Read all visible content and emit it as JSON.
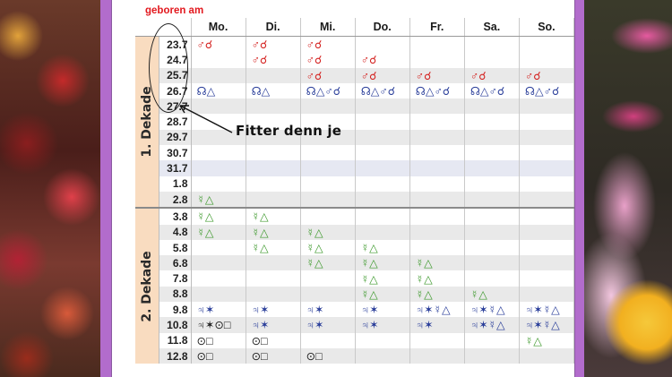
{
  "header": {
    "label": "geboren am"
  },
  "colors": {
    "red": "#d4201e",
    "blue": "#2a3e9a",
    "green": "#3f9a2e",
    "dekade_bg": "#f9dcc0",
    "frame": "#b26ccc"
  },
  "days": [
    "Mo.",
    "Di.",
    "Mi.",
    "Do.",
    "Fr.",
    "Sa.",
    "So."
  ],
  "annotation": "Fitter denn je",
  "dekaden": [
    {
      "label": "1. Dekade",
      "rows": [
        {
          "date": "23.7",
          "shade": "",
          "cells": [
            [
              "♂☌",
              "red"
            ],
            [
              "♂☌",
              "red"
            ],
            [
              "♂☌",
              "red"
            ],
            [
              "",
              ""
            ],
            [
              "",
              ""
            ],
            [
              "",
              ""
            ],
            [
              "",
              ""
            ]
          ]
        },
        {
          "date": "24.7",
          "shade": "",
          "cells": [
            [
              "",
              ""
            ],
            [
              "♂☌",
              "red"
            ],
            [
              "♂☌",
              "red"
            ],
            [
              "♂☌",
              "red"
            ],
            [
              "",
              ""
            ],
            [
              "",
              ""
            ],
            [
              "",
              ""
            ]
          ]
        },
        {
          "date": "25.7",
          "shade": "shade",
          "cells": [
            [
              "",
              ""
            ],
            [
              "",
              ""
            ],
            [
              "♂☌",
              "red"
            ],
            [
              "♂☌",
              "red"
            ],
            [
              "♂☌",
              "red"
            ],
            [
              "♂☌",
              "red"
            ],
            [
              "♂☌",
              "red"
            ]
          ]
        },
        {
          "date": "26.7",
          "shade": "",
          "cells": [
            [
              "☊△",
              "blue"
            ],
            [
              "☊△",
              "blue"
            ],
            [
              "☊△♂☌",
              "blue"
            ],
            [
              "☊△♂☌",
              "blue"
            ],
            [
              "☊△♂☌",
              "blue"
            ],
            [
              "☊△♂☌",
              "blue"
            ],
            [
              "☊△♂☌",
              "blue"
            ]
          ]
        },
        {
          "date": "27.7",
          "shade": "shade",
          "cells": [
            [
              "",
              ""
            ],
            [
              "",
              ""
            ],
            [
              "",
              ""
            ],
            [
              "",
              ""
            ],
            [
              "",
              ""
            ],
            [
              "",
              ""
            ],
            [
              "",
              ""
            ]
          ]
        },
        {
          "date": "28.7",
          "shade": "",
          "cells": [
            [
              "",
              ""
            ],
            [
              "",
              ""
            ],
            [
              "",
              ""
            ],
            [
              "",
              ""
            ],
            [
              "",
              ""
            ],
            [
              "",
              ""
            ],
            [
              "",
              ""
            ]
          ]
        },
        {
          "date": "29.7",
          "shade": "shade",
          "cells": [
            [
              "",
              ""
            ],
            [
              "",
              ""
            ],
            [
              "",
              ""
            ],
            [
              "",
              ""
            ],
            [
              "",
              ""
            ],
            [
              "",
              ""
            ],
            [
              "",
              ""
            ]
          ]
        },
        {
          "date": "30.7",
          "shade": "",
          "cells": [
            [
              "",
              ""
            ],
            [
              "",
              ""
            ],
            [
              "",
              ""
            ],
            [
              "",
              ""
            ],
            [
              "",
              ""
            ],
            [
              "",
              ""
            ],
            [
              "",
              ""
            ]
          ]
        },
        {
          "date": "31.7",
          "shade": "shade-blue",
          "cells": [
            [
              "",
              ""
            ],
            [
              "",
              ""
            ],
            [
              "",
              ""
            ],
            [
              "",
              ""
            ],
            [
              "",
              ""
            ],
            [
              "",
              ""
            ],
            [
              "",
              ""
            ]
          ]
        },
        {
          "date": "1.8",
          "shade": "",
          "cells": [
            [
              "",
              ""
            ],
            [
              "",
              ""
            ],
            [
              "",
              ""
            ],
            [
              "",
              ""
            ],
            [
              "",
              ""
            ],
            [
              "",
              ""
            ],
            [
              "",
              ""
            ]
          ]
        },
        {
          "date": "2.8",
          "shade": "shade",
          "cells": [
            [
              "☿△",
              "green"
            ],
            [
              "",
              ""
            ],
            [
              "",
              ""
            ],
            [
              "",
              ""
            ],
            [
              "",
              ""
            ],
            [
              "",
              ""
            ],
            [
              "",
              ""
            ]
          ]
        }
      ]
    },
    {
      "label": "2. Dekade",
      "rows": [
        {
          "date": "3.8",
          "shade": "",
          "cells": [
            [
              "☿△",
              "green"
            ],
            [
              "☿△",
              "green"
            ],
            [
              "",
              ""
            ],
            [
              "",
              ""
            ],
            [
              "",
              ""
            ],
            [
              "",
              ""
            ],
            [
              "",
              ""
            ]
          ]
        },
        {
          "date": "4.8",
          "shade": "shade",
          "cells": [
            [
              "☿△",
              "green"
            ],
            [
              "☿△",
              "green"
            ],
            [
              "☿△",
              "green"
            ],
            [
              "",
              ""
            ],
            [
              "",
              ""
            ],
            [
              "",
              ""
            ],
            [
              "",
              ""
            ]
          ]
        },
        {
          "date": "5.8",
          "shade": "",
          "cells": [
            [
              "",
              ""
            ],
            [
              "☿△",
              "green"
            ],
            [
              "☿△",
              "green"
            ],
            [
              "☿△",
              "green"
            ],
            [
              "",
              ""
            ],
            [
              "",
              ""
            ],
            [
              "",
              ""
            ]
          ]
        },
        {
          "date": "6.8",
          "shade": "shade",
          "cells": [
            [
              "",
              ""
            ],
            [
              "",
              ""
            ],
            [
              "☿△",
              "green"
            ],
            [
              "☿△",
              "green"
            ],
            [
              "☿△",
              "green"
            ],
            [
              "",
              ""
            ],
            [
              "",
              ""
            ]
          ]
        },
        {
          "date": "7.8",
          "shade": "",
          "cells": [
            [
              "",
              ""
            ],
            [
              "",
              ""
            ],
            [
              "",
              ""
            ],
            [
              "☿△",
              "green"
            ],
            [
              "☿△",
              "green"
            ],
            [
              "",
              ""
            ],
            [
              "",
              ""
            ]
          ]
        },
        {
          "date": "8.8",
          "shade": "shade",
          "cells": [
            [
              "",
              ""
            ],
            [
              "",
              ""
            ],
            [
              "",
              ""
            ],
            [
              "☿△",
              "green"
            ],
            [
              "☿△",
              "green"
            ],
            [
              "☿△",
              "green"
            ],
            [
              "",
              ""
            ]
          ]
        },
        {
          "date": "9.8",
          "shade": "",
          "cells": [
            [
              "♃✶",
              "blue"
            ],
            [
              "♃✶",
              "blue"
            ],
            [
              "♃✶",
              "blue"
            ],
            [
              "♃✶",
              "blue"
            ],
            [
              "♃✶☿△",
              "blue"
            ],
            [
              "♃✶☿△",
              "blue"
            ],
            [
              "♃✶☿△",
              "blue"
            ]
          ]
        },
        {
          "date": "10.8",
          "shade": "shade",
          "cells": [
            [
              "♃✶⊙□",
              "black"
            ],
            [
              "♃✶",
              "blue"
            ],
            [
              "♃✶",
              "blue"
            ],
            [
              "♃✶",
              "blue"
            ],
            [
              "♃✶",
              "blue"
            ],
            [
              "♃✶☿△",
              "blue"
            ],
            [
              "♃✶☿△",
              "blue"
            ]
          ]
        },
        {
          "date": "11.8",
          "shade": "",
          "cells": [
            [
              "⊙□",
              "black"
            ],
            [
              "⊙□",
              "black"
            ],
            [
              "",
              ""
            ],
            [
              "",
              ""
            ],
            [
              "",
              ""
            ],
            [
              "",
              ""
            ],
            [
              "☿△",
              "green"
            ]
          ]
        },
        {
          "date": "12.8",
          "shade": "shade",
          "cells": [
            [
              "⊙□",
              "black"
            ],
            [
              "⊙□",
              "black"
            ],
            [
              "⊙□",
              "black"
            ],
            [
              "",
              ""
            ],
            [
              "",
              ""
            ],
            [
              "",
              ""
            ],
            [
              "",
              ""
            ]
          ]
        }
      ]
    }
  ]
}
